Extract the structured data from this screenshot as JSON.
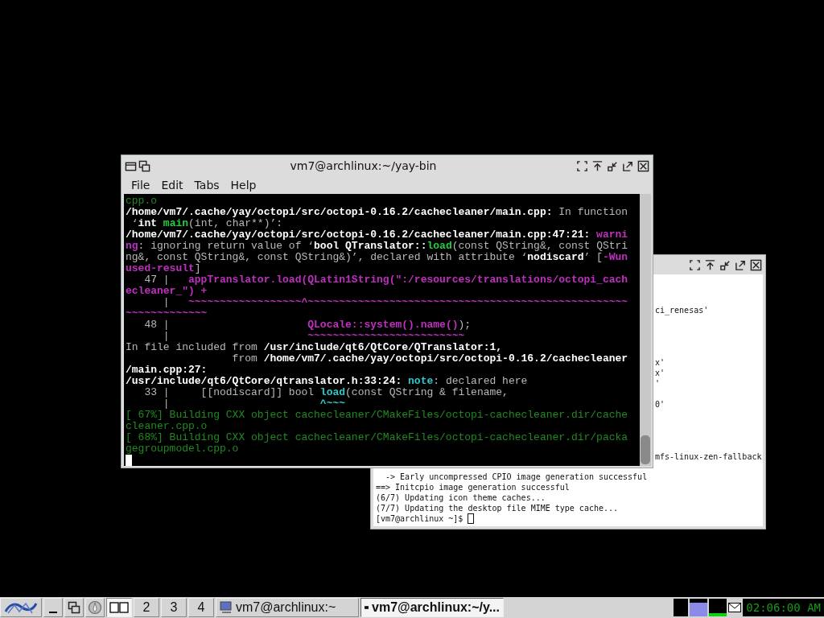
{
  "back_window": {
    "fragments": [
      "ci_renesas'",
      "x'",
      "x'",
      "'",
      "0'",
      "mfs-linux-zen-fallback"
    ],
    "lines": [
      "  -> Early uncompressed CPIO image generation successful",
      "==> Initcpio image generation successful",
      "(6/7) Updating icon theme caches...",
      "(7/7) Updating the desktop file MIME type cache...",
      "[vm7@archlinux ~]$ "
    ]
  },
  "main_window": {
    "title": "vm7@archlinux:~/yay-bin",
    "menu": [
      "File",
      "Edit",
      "Tabs",
      "Help"
    ],
    "terminal": [
      [
        {
          "kind": "build",
          "text": "cpp.o"
        }
      ],
      [
        {
          "kind": "bold",
          "text": "/home/vm7/.cache/yay/octopi/src/octopi-0.16.2/cachecleaner/main.cpp:"
        },
        {
          "kind": "plain",
          "text": " In function"
        }
      ],
      [
        {
          "kind": "plain",
          "text": " ‘"
        },
        {
          "kind": "bold",
          "text": "int "
        },
        {
          "kind": "green",
          "text": "main"
        },
        {
          "kind": "plain",
          "text": "(int, char**)’:"
        }
      ],
      [
        {
          "kind": "bold",
          "text": "/home/vm7/.cache/yay/octopi/src/octopi-0.16.2/cachecleaner/main.cpp:47:21: "
        },
        {
          "kind": "magenta",
          "text": "warni"
        }
      ],
      [
        {
          "kind": "magenta",
          "text": "ng"
        },
        {
          "kind": "plain",
          "text": ": ignoring return value of ‘"
        },
        {
          "kind": "bold",
          "text": "bool QTranslator::"
        },
        {
          "kind": "green",
          "text": "load"
        },
        {
          "kind": "plain",
          "text": "(const QString&, const QStri"
        }
      ],
      [
        {
          "kind": "plain",
          "text": "ng&, const QString&, const QString&)’, declared with attribute ‘"
        },
        {
          "kind": "bold",
          "text": "nodiscard"
        },
        {
          "kind": "plain",
          "text": "’ ["
        },
        {
          "kind": "magenta",
          "text": "-Wun"
        }
      ],
      [
        {
          "kind": "magenta",
          "text": "used-result"
        },
        {
          "kind": "plain",
          "text": "]"
        }
      ],
      [
        {
          "kind": "plain",
          "text": "   47 |   "
        },
        {
          "kind": "magenta",
          "text": "appTranslator.load(QLatin1String(\":/resources/translations/octopi_cach"
        }
      ],
      [
        {
          "kind": "magenta",
          "text": "ecleaner_\") +"
        }
      ],
      [
        {
          "kind": "plain",
          "text": "      |   "
        },
        {
          "kind": "magenta",
          "text": "~~~~~~~~~~~~~~~~~~^~~~~~~~~~~~~~~~~~~~~~~~~~~~~~~~~~~~~~~~~~~~~~~~~~~~"
        }
      ],
      [
        {
          "kind": "magenta",
          "text": "~~~~~~~~~~~~~"
        }
      ],
      [
        {
          "kind": "plain",
          "text": "   48 |                      "
        },
        {
          "kind": "magenta",
          "text": "QLocale::system().name()"
        },
        {
          "kind": "plain",
          "text": ");"
        }
      ],
      [
        {
          "kind": "plain",
          "text": "      |                      "
        },
        {
          "kind": "magenta",
          "text": "~~~~~~~~~~~~~~~~~~~~~~~~~"
        }
      ],
      [
        {
          "kind": "plain",
          "text": "In file included from "
        },
        {
          "kind": "bold",
          "text": "/usr/include/qt6/QtCore/QTranslator:1,"
        }
      ],
      [
        {
          "kind": "plain",
          "text": "                 from "
        },
        {
          "kind": "bold",
          "text": "/home/vm7/.cache/yay/octopi/src/octopi-0.16.2/cachecleaner"
        }
      ],
      [
        {
          "kind": "bold",
          "text": "/main.cpp:27:"
        }
      ],
      [
        {
          "kind": "bold",
          "text": "/usr/include/qt6/QtCore/qtranslator.h:33:24: "
        },
        {
          "kind": "cyan",
          "text": "note"
        },
        {
          "kind": "plain",
          "text": ": declared here"
        }
      ],
      [
        {
          "kind": "plain",
          "text": "   33 |     [[nodiscard]] bool "
        },
        {
          "kind": "cyan",
          "text": "load"
        },
        {
          "kind": "plain",
          "text": "(const QString & filename,"
        }
      ],
      [
        {
          "kind": "plain",
          "text": "      |                        "
        },
        {
          "kind": "cyan",
          "text": "^~~~"
        }
      ],
      [
        {
          "kind": "build",
          "text": "[ 67%] Building CXX object cachecleaner/CMakeFiles/octopi-cachecleaner.dir/cache"
        }
      ],
      [
        {
          "kind": "build",
          "text": "cleaner.cpp.o"
        }
      ],
      [
        {
          "kind": "build",
          "text": "[ 68%] Building CXX object cachecleaner/CMakeFiles/octopi-cachecleaner.dir/packa"
        }
      ],
      [
        {
          "kind": "build",
          "text": "gegroupmodel.cpp.o"
        }
      ]
    ]
  },
  "taskbar": {
    "workspaces": [
      {
        "kind": "icon",
        "selected": true
      },
      {
        "kind": "number",
        "label": "2",
        "selected": false
      },
      {
        "kind": "number",
        "label": "3",
        "selected": false
      },
      {
        "kind": "number",
        "label": "4",
        "selected": false
      }
    ],
    "tasks": [
      {
        "label": "vm7@archlinux:~",
        "selected": false
      },
      {
        "label": "vm7@archlinux:~/y...",
        "selected": true
      }
    ],
    "clock": "02:06:00 AM"
  }
}
